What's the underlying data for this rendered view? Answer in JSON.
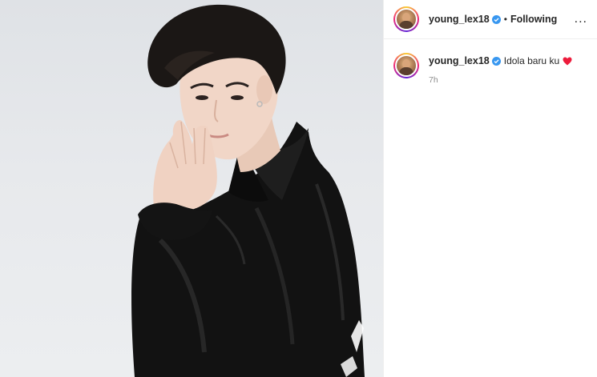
{
  "post": {
    "author": {
      "username": "young_lex18",
      "verified": true,
      "avatar_icon": "profile-avatar"
    },
    "separator": "•",
    "follow_status": "Following",
    "more_icon": "more-options-icon",
    "more_label": "...",
    "caption": {
      "username": "young_lex18",
      "text": "Idola baru ku",
      "emoji": "red-heart",
      "time": "7h"
    },
    "colors": {
      "verified_badge": "#3897f0",
      "heart": "#ed1c3c",
      "muted_text": "#8e8e8e"
    }
  }
}
